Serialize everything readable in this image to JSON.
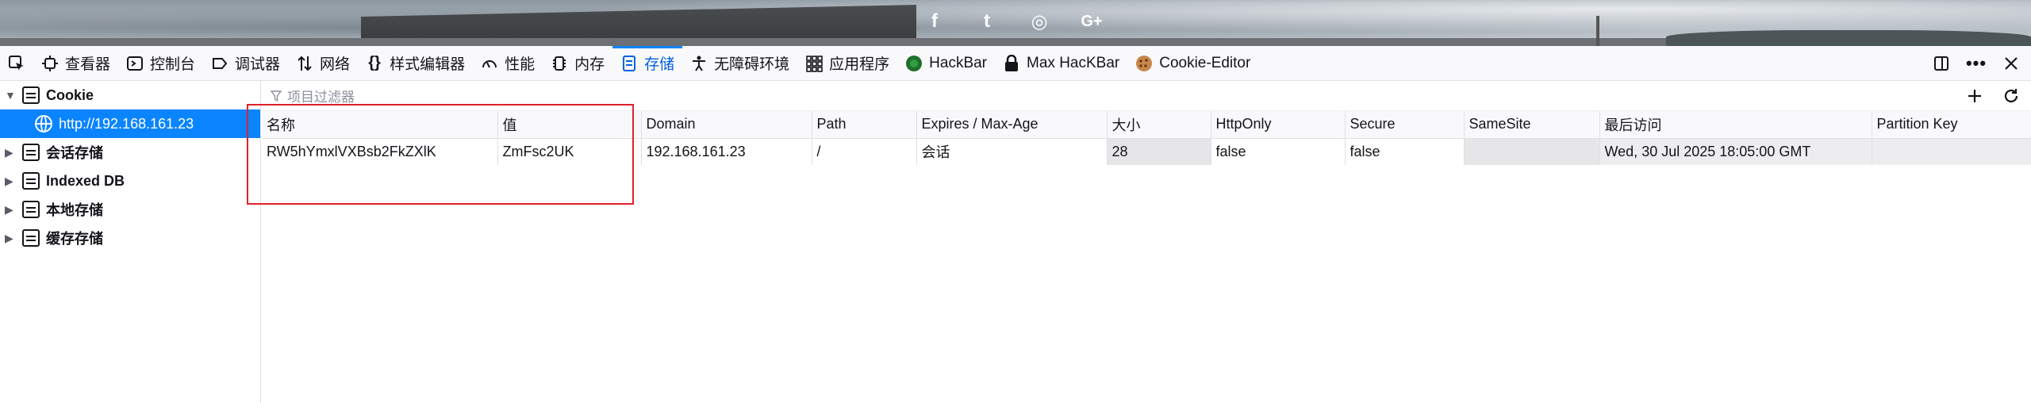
{
  "banner": {
    "social_icons": [
      {
        "icon": "facebook-icon",
        "glyph": "f"
      },
      {
        "icon": "twitter-icon",
        "glyph": "t"
      },
      {
        "icon": "instagram-icon",
        "glyph": "◎"
      },
      {
        "icon": "google-plus-icon",
        "glyph": "G+"
      }
    ]
  },
  "toolbar": {
    "tabs": [
      {
        "label": "查看器",
        "icon": "inspector-icon"
      },
      {
        "label": "控制台",
        "icon": "console-icon"
      },
      {
        "label": "调试器",
        "icon": "debugger-icon"
      },
      {
        "label": "网络",
        "icon": "network-icon"
      },
      {
        "label": "样式编辑器",
        "icon": "style-editor-icon"
      },
      {
        "label": "性能",
        "icon": "performance-icon"
      },
      {
        "label": "内存",
        "icon": "memory-icon"
      },
      {
        "label": "存储",
        "icon": "storage-icon"
      },
      {
        "label": "无障碍环境",
        "icon": "accessibility-icon"
      },
      {
        "label": "应用程序",
        "icon": "application-icon"
      },
      {
        "label": "HackBar",
        "icon": "hackbar-icon"
      },
      {
        "label": "Max HacKBar",
        "icon": "max-hackbar-icon"
      },
      {
        "label": "Cookie-Editor",
        "icon": "cookie-editor-icon"
      }
    ],
    "active_tab": "存储",
    "accent_color": "#0a84ff"
  },
  "sidebar": {
    "cookie_label": "Cookie",
    "cookie_host": "http://192.168.161.23",
    "items": [
      {
        "label": "会话存储"
      },
      {
        "label": "Indexed DB"
      },
      {
        "label": "本地存储"
      },
      {
        "label": "缓存存储"
      }
    ]
  },
  "filter": {
    "placeholder": "项目过滤器"
  },
  "table": {
    "headers": [
      "名称",
      "值",
      "Domain",
      "Path",
      "Expires / Max-Age",
      "大小",
      "HttpOnly",
      "Secure",
      "SameSite",
      "最后访问",
      "Partition Key"
    ],
    "rows": [
      [
        "RW5hYmxlVXBsb2FkZXlK",
        "ZmFsc2UK",
        "192.168.161.23",
        "/",
        "会话",
        "28",
        "false",
        "false",
        "",
        "Wed, 30 Jul 2025 18:05:00 GMT",
        ""
      ]
    ]
  },
  "highlight_color": "#e0202b"
}
